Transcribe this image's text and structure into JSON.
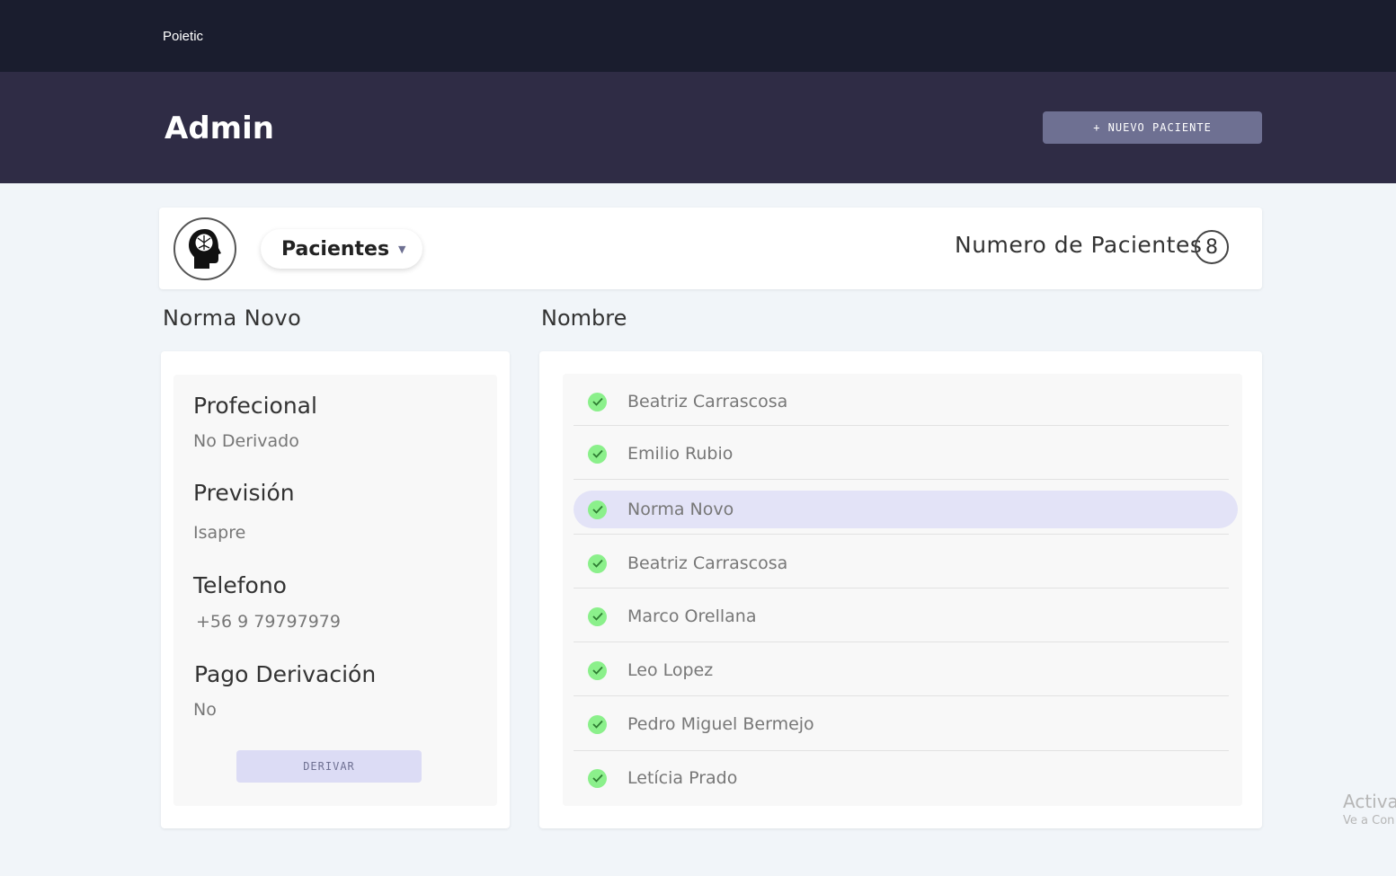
{
  "nav": {
    "brand": "Poietic"
  },
  "header": {
    "title": "Admin",
    "new_patient_button": "+ NUEVO PACIENTE"
  },
  "toolbar": {
    "selector_label": "Pacientes",
    "count_label": "Numero de Pacientes",
    "count_value": "8"
  },
  "detail": {
    "selected_name": "Norma Novo",
    "fields": [
      {
        "label": "Profecional",
        "value": "No Derivado"
      },
      {
        "label": "Previsión",
        "value": "Isapre"
      },
      {
        "label": "Telefono",
        "value": "+56 9 79797979"
      },
      {
        "label": "Pago Derivación",
        "value": "No"
      }
    ],
    "derive_button": "DERIVAR"
  },
  "list": {
    "heading": "Nombre",
    "patients": [
      {
        "name": "Beatriz Carrascosa",
        "selected": false
      },
      {
        "name": "Emilio Rubio",
        "selected": false
      },
      {
        "name": "Norma Novo",
        "selected": true
      },
      {
        "name": "Beatriz Carrascosa",
        "selected": false
      },
      {
        "name": "Marco Orellana",
        "selected": false
      },
      {
        "name": "Leo Lopez",
        "selected": false
      },
      {
        "name": "Pedro Miguel Bermejo",
        "selected": false
      },
      {
        "name": "Letícia Prado",
        "selected": false
      }
    ]
  },
  "watermark": {
    "line1": "Activar",
    "line2": "Ve a Con"
  },
  "icons": {
    "avatar": "head-brain-icon",
    "caret": "caret-down-icon",
    "check": "check-circle-icon"
  },
  "colors": {
    "accent": "#6e7092",
    "check": "#8bf08b",
    "selected_row": "#e3e3f7"
  }
}
